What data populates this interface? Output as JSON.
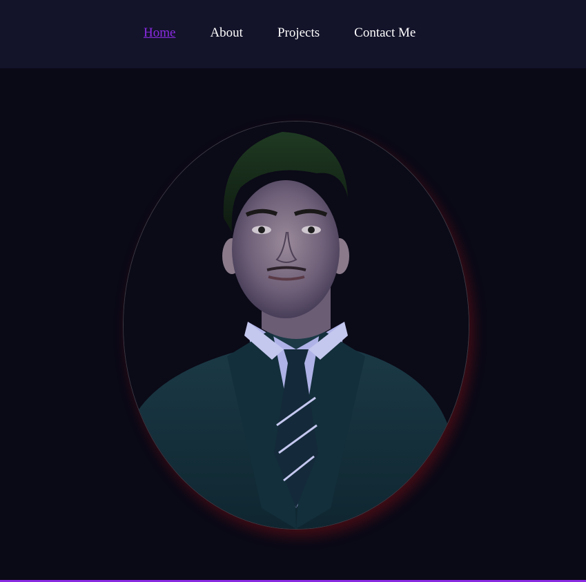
{
  "nav": {
    "items": [
      {
        "label": "Home",
        "active": true
      },
      {
        "label": "About",
        "active": false
      },
      {
        "label": "Projects",
        "active": false
      },
      {
        "label": "Contact Me",
        "active": false
      }
    ]
  },
  "colors": {
    "accent": "#8a2be2",
    "nav_bg": "#13132a",
    "page_bg": "#0a0916",
    "glow": "#aa1414"
  },
  "hero": {
    "image": "profile-portrait"
  }
}
